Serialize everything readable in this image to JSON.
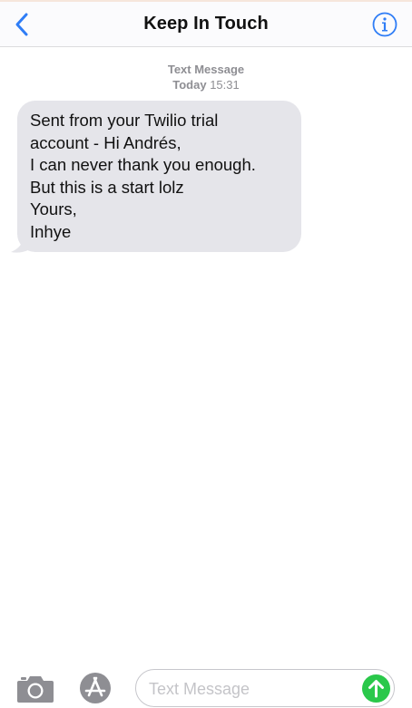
{
  "header": {
    "title": "Keep In Touch",
    "back_icon": "chevron-left-icon",
    "info_icon": "info-icon"
  },
  "conversation": {
    "message_type": "Text Message",
    "day": "Today",
    "time": "15:31",
    "messages": [
      {
        "direction": "incoming",
        "text": "Sent from your Twilio trial\naccount - Hi Andrés,\nI can never thank you enough.\nBut this is a start lolz\nYours,\nInhye"
      }
    ]
  },
  "composer": {
    "placeholder": "Text Message",
    "value": "",
    "camera_icon": "camera-icon",
    "apps_icon": "app-store-icon",
    "send_icon": "send-arrow-icon"
  },
  "colors": {
    "accent": "#2f7df6",
    "bubble_incoming": "#e5e5ea",
    "send": "#2ac84a",
    "meta_text": "#8e8e93"
  }
}
